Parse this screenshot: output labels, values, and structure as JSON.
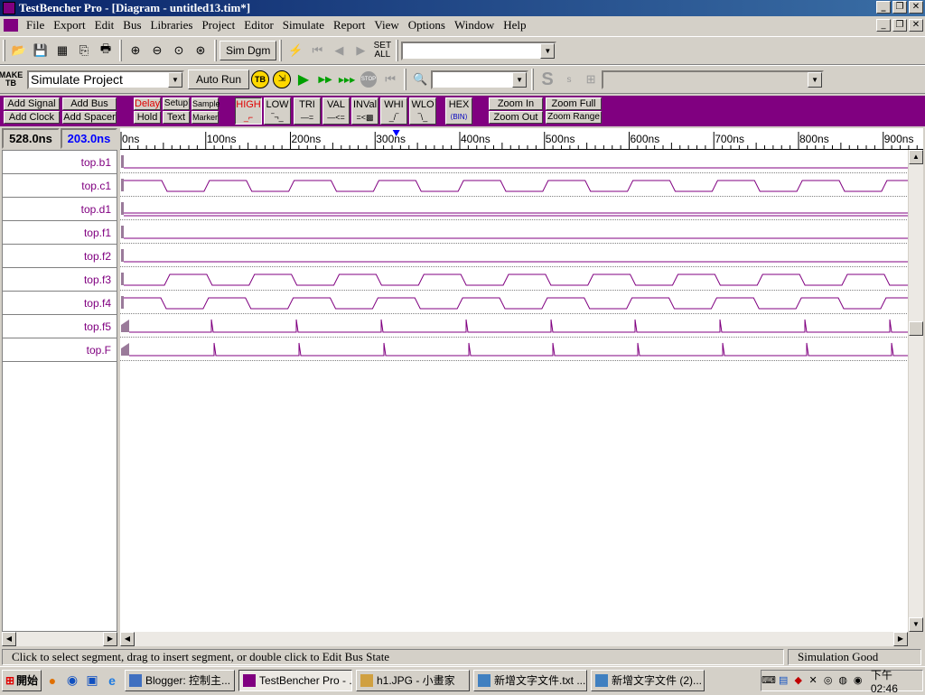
{
  "window": {
    "title": "TestBencher Pro - [Diagram - untitled13.tim*]"
  },
  "menu": [
    "File",
    "Export",
    "Edit",
    "Bus",
    "Libraries",
    "Project",
    "Editor",
    "Simulate",
    "Report",
    "View",
    "Options",
    "Window",
    "Help"
  ],
  "toolbar1": {
    "sim_dgm": "Sim Dgm",
    "set_all_top": "SET",
    "set_all_bottom": "ALL"
  },
  "toolbar2": {
    "make_tb_top": "MAKE",
    "make_tb_bottom": "TB",
    "project_combo": "Simulate Project",
    "auto_run": "Auto Run",
    "tb_badge": "TB",
    "stop": "STOP"
  },
  "signal_bar": {
    "add_signal": "Add Signal",
    "add_bus": "Add Bus",
    "add_clock": "Add Clock",
    "add_spacer": "Add Spacer",
    "delay": "Delay",
    "setup": "Setup",
    "sample": "Sample",
    "hold": "Hold",
    "text": "Text",
    "marker": "Marker",
    "high": "HIGH",
    "low": "LOW",
    "tri": "TRI",
    "val": "VAL",
    "inval": "INVal",
    "whi": "WHI",
    "wlo": "WLO",
    "hex": "HEX",
    "zoom_in": "Zoom In",
    "zoom_full": "Zoom Full",
    "zoom_out": "Zoom Out",
    "zoom_range": "Zoom Range"
  },
  "times": {
    "cursor": "528.0ns",
    "delta": "203.0ns"
  },
  "ruler_labels": [
    "0ns",
    "100ns",
    "200ns",
    "300ns",
    "400ns",
    "500ns",
    "600ns",
    "700ns",
    "800ns",
    "900ns"
  ],
  "signals": [
    "top.b1",
    "top.c1",
    "top.d1",
    "top.f1",
    "top.f2",
    "top.f3",
    "top.f4",
    "top.f5",
    "top.F"
  ],
  "status": {
    "hint": "Click to select segment, drag to insert segment, or double click to Edit Bus State",
    "sim": "Simulation Good"
  },
  "taskbar": {
    "start": "開始",
    "tasks": [
      "Blogger: 控制主...",
      "TestBencher Pro - ...",
      "h1.JPG - 小畫家",
      "新增文字文件.txt ...",
      "新增文字文件 (2)..."
    ],
    "clock": "下午 02:46"
  },
  "colors": {
    "signal": "#800080",
    "purple_bar": "#800080",
    "delta_time": "#0000ff"
  }
}
